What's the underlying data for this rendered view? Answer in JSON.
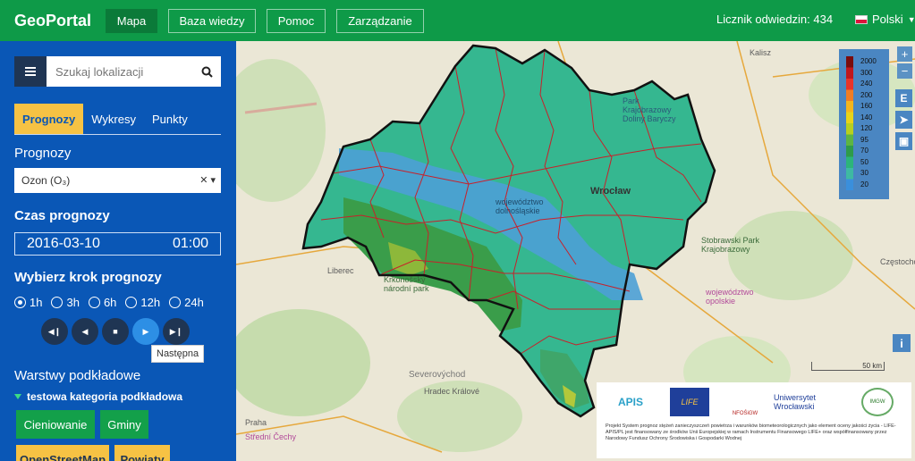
{
  "header": {
    "brand": "GeoPortal",
    "nav": [
      "Mapa",
      "Baza wiedzy",
      "Pomoc",
      "Zarządzanie"
    ],
    "counter": "Licznik odwiedzin: 434",
    "language": "Polski"
  },
  "sidebar": {
    "search_placeholder": "Szukaj lokalizacji",
    "tabs": [
      "Prognozy",
      "Wykresy",
      "Punkty"
    ],
    "forecast_label": "Prognozy",
    "forecast_select": "Ozon (O₃)",
    "time_label": "Czas prognozy",
    "time_date": "2016-03-10",
    "time_hour": "01:00",
    "step_label": "Wybierz krok prognozy",
    "steps": [
      "1h",
      "3h",
      "6h",
      "12h",
      "24h"
    ],
    "selected_step": "1h",
    "tooltip": "Następna",
    "layers_label": "Warstwy podkładowe",
    "layer_category": "testowa kategoria podkładowa",
    "layers": [
      "Cieniowanie",
      "Gminy",
      "OpenStreetMap",
      "Powiaty"
    ]
  },
  "map": {
    "labels": {
      "kalisz": "Kalisz",
      "wroclaw": "Wrocław",
      "park_barycz": "Park Krajobrazowy Doliny Baryczy",
      "stobrawski": "Stobrawski Park Krajobrazowy",
      "czestochowa": "Częstochowa",
      "woj_opolskie": "województwo opolskie",
      "liberec": "Liberec",
      "krkonosky": "Krkonošský národní park",
      "severovychod": "Severovýchod",
      "hradec": "Hradec Králové",
      "praha": "Praha",
      "stredni_cechy": "Střední Čechy",
      "dolnoslaskie": "województwo dolnośląskie"
    },
    "zoom_in": "+",
    "zoom_out": "−",
    "scale_label": "50 km",
    "legend": {
      "values": [
        "2000",
        "300",
        "240",
        "200",
        "160",
        "140",
        "120",
        "95",
        "70",
        "50",
        "30",
        "20"
      ],
      "colors": [
        "#7a0c0c",
        "#c0171d",
        "#e8332a",
        "#f07d24",
        "#f4b51c",
        "#e8d319",
        "#b7cf20",
        "#5db443",
        "#2e9b4a",
        "#2cb47a",
        "#3eb9a2",
        "#3a8fdc"
      ]
    },
    "partners_text": "Projekt System prognoz stężeń zanieczyszczeń powietrza i warunków biometeorologicznych jako element oceny jakości życia - LIFE-APIS/PL jest finansowany ze środków Unii Europejskiej w ramach Instrumentu Finansowego LIFE+ oraz współfinansowany przez Narodowy Fundusz Ochrony Środowiska i Gospodarki Wodnej",
    "partner_logos": [
      "APIS",
      "LIFE",
      "NFOŚiGW",
      "Uniwersytet Wrocławski",
      "IMGW"
    ]
  }
}
